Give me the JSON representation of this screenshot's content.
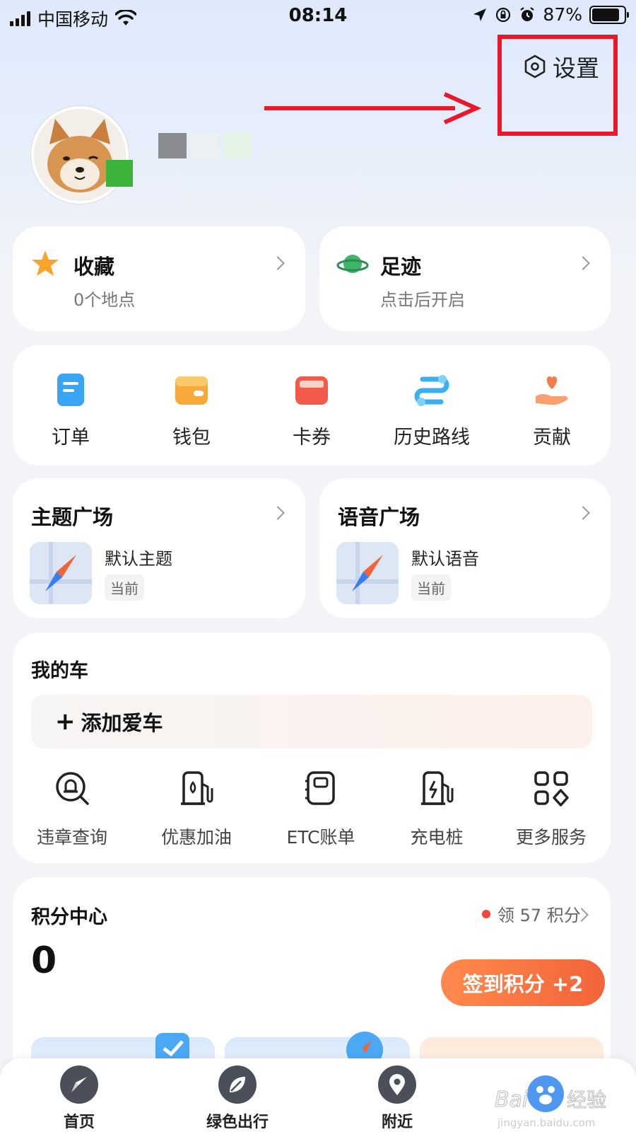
{
  "status_bar": {
    "carrier": "中国移动",
    "time": "08:14",
    "battery": "87%",
    "battery_level": 0.87
  },
  "header": {
    "settings_label": "设置"
  },
  "favorites": {
    "title": "收藏",
    "subtitle": "0个地点"
  },
  "footprint": {
    "title": "足迹",
    "subtitle": "点击后开启"
  },
  "quick_actions": [
    {
      "label": "订单",
      "icon": "order-icon"
    },
    {
      "label": "钱包",
      "icon": "wallet-icon"
    },
    {
      "label": "卡券",
      "icon": "coupon-icon"
    },
    {
      "label": "历史路线",
      "icon": "history-route-icon"
    },
    {
      "label": "贡献",
      "icon": "contribute-icon"
    }
  ],
  "theme_plaza": {
    "title": "主题广场",
    "item": "默认主题",
    "tag": "当前"
  },
  "voice_plaza": {
    "title": "语音广场",
    "item": "默认语音",
    "tag": "当前"
  },
  "my_car": {
    "title": "我的车",
    "add_car": "添加爱车",
    "services": [
      {
        "label": "违章查询",
        "icon": "violation-query-icon"
      },
      {
        "label": "优惠加油",
        "icon": "fuel-pump-icon"
      },
      {
        "label": "ETC账单",
        "icon": "etc-bill-icon"
      },
      {
        "label": "充电桩",
        "icon": "charging-pile-icon"
      },
      {
        "label": "更多服务",
        "icon": "more-services-icon"
      }
    ]
  },
  "points": {
    "title": "积分中心",
    "claim": "领 57 积分",
    "value": "0",
    "signin": "签到积分 +2"
  },
  "bottom_nav": [
    {
      "label": "首页",
      "icon": "compass-icon"
    },
    {
      "label": "绿色出行",
      "icon": "leaf-icon"
    },
    {
      "label": "附近",
      "icon": "location-pin-icon"
    }
  ],
  "colors": {
    "accent_red": "#e8192c",
    "signin_orange": "#f2633a",
    "avatar_badge": "#3cb33a"
  }
}
